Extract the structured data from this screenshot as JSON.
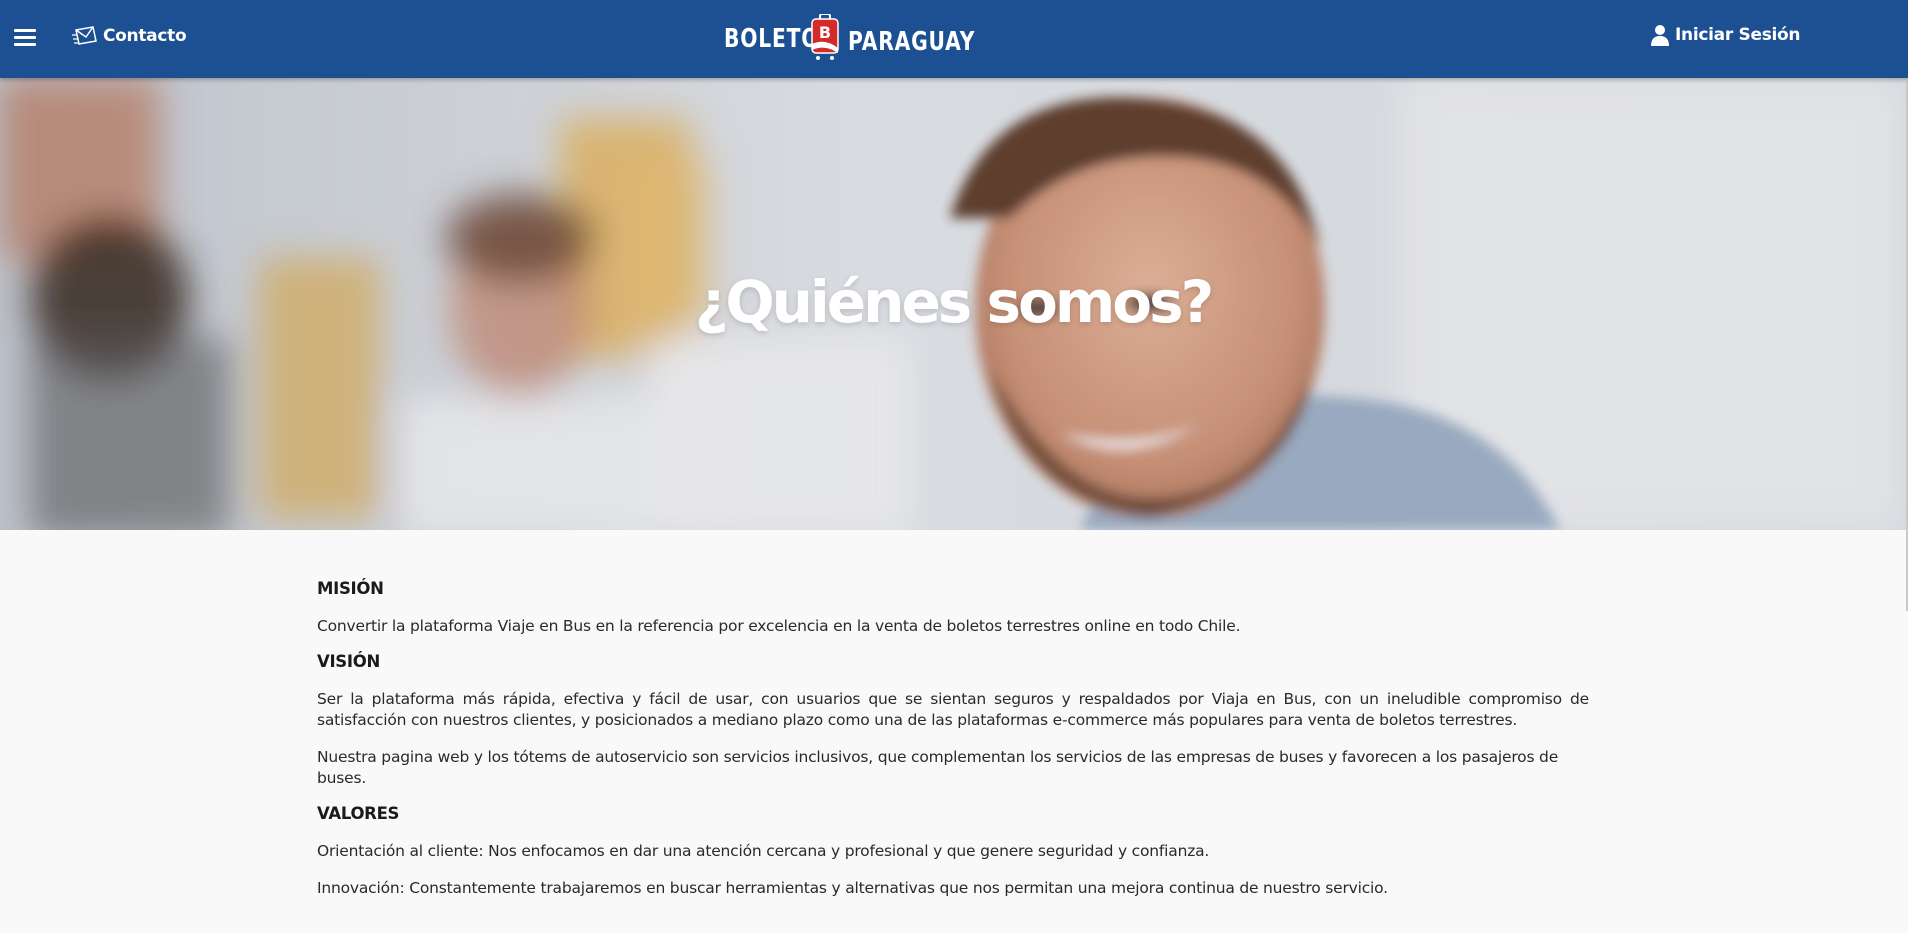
{
  "header": {
    "contact_label": "Contacto",
    "logo_word1": "BOLETOS",
    "logo_badge": "B",
    "logo_word2": "PARAGUAY",
    "login_label": "Iniciar Sesión"
  },
  "hero": {
    "title": "¿Quiénes somos?"
  },
  "content": {
    "mision_heading": "MISIÓN",
    "mision_text": "Convertir la plataforma Viaje en Bus en la referencia por excelencia en la venta de boletos terrestres online en todo Chile.",
    "vision_heading": "VISIÓN",
    "vision_text": "Ser la plataforma más rápida, efectiva y fácil de usar, con usuarios que se sientan seguros y respaldados por Viaja en Bus, con un ineludible compromiso de satisfacción con nuestros clientes, y posicionados a mediano plazo como una de las plataformas e-commerce más populares para venta de boletos terrestres.",
    "vision_text2": "Nuestra pagina web y los tótems de autoservicio son servicios inclusivos, que complementan los servicios de las empresas de buses y favorecen a los pasajeros de buses.",
    "valores_heading": "VALORES",
    "valores_item1": "Orientación al cliente: Nos enfocamos en dar una atención cercana y profesional y que genere seguridad y confianza.",
    "valores_item2": "Innovación: Constantemente trabajaremos en buscar herramientas y alternativas que nos permitan una mejora continua de nuestro servicio."
  },
  "colors": {
    "header_bg": "#1c5093",
    "logo_badge": "#d42a2a",
    "page_bg": "#f9f9f9"
  },
  "icons": [
    "menu-icon",
    "mail-icon",
    "user-icon"
  ]
}
